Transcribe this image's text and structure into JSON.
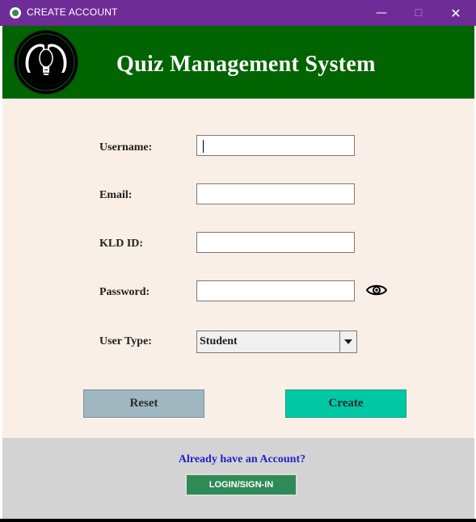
{
  "window": {
    "title": "CREATE ACCOUNT",
    "minimize_glyph": "—",
    "maximize_glyph": "☐",
    "close_glyph": "✕",
    "titlebar_color": "#6e2c96"
  },
  "header": {
    "title": "Quiz Management System",
    "logo_icon": "lightbulb-heads-logo",
    "background_color": "#006400"
  },
  "form": {
    "background_color": "#faefe6",
    "fields": {
      "username": {
        "label": "Username:",
        "value": ""
      },
      "email": {
        "label": "Email:",
        "value": ""
      },
      "kld_id": {
        "label": "KLD ID:",
        "value": ""
      },
      "password": {
        "label": "Password:",
        "value": "",
        "toggle_icon": "eye-icon"
      }
    },
    "user_type": {
      "label": "User Type:",
      "selected": "Student"
    },
    "buttons": {
      "reset": "Reset",
      "create": "Create"
    }
  },
  "footer": {
    "prompt": "Already have an Account?",
    "login_button": "LOGIN/SIGN-IN",
    "background_color": "#d3d3d3"
  },
  "colors": {
    "reset_button": "#9fb7c1",
    "create_button": "#00c7a4",
    "login_button": "#2e8b57",
    "link_text": "#1f1fcc"
  }
}
